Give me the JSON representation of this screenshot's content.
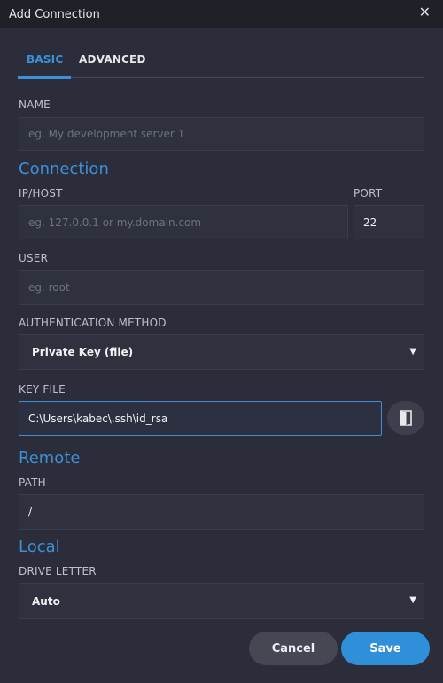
{
  "window": {
    "title": "Add Connection",
    "close_icon": "close-icon"
  },
  "tabs": [
    {
      "label": "BASIC",
      "active": true
    },
    {
      "label": "ADVANCED",
      "active": false
    }
  ],
  "name": {
    "label": "NAME",
    "placeholder": "eg. My development server 1",
    "value": ""
  },
  "connection": {
    "heading": "Connection",
    "host": {
      "label": "IP/HOST",
      "placeholder": "eg. 127.0.0.1 or my.domain.com",
      "value": ""
    },
    "port": {
      "label": "PORT",
      "value": "22"
    },
    "user": {
      "label": "USER",
      "placeholder": "eg. root",
      "value": ""
    },
    "auth": {
      "label": "AUTHENTICATION METHOD",
      "selected": "Private Key (file)"
    },
    "keyfile": {
      "label": "KEY FILE",
      "value": "C:\\Users\\kabec\\.ssh\\id_rsa",
      "browse_icon": "folder-icon"
    }
  },
  "remote": {
    "heading": "Remote",
    "path": {
      "label": "PATH",
      "value": "/"
    }
  },
  "local": {
    "heading": "Local",
    "drive": {
      "label": "DRIVE LETTER",
      "selected": "Auto"
    }
  },
  "actions": {
    "cancel_label": "Cancel",
    "save_label": "Save"
  },
  "colors": {
    "accent": "#3d8fd8",
    "background": "#2b2e3a",
    "titlebar": "#1f2128"
  }
}
